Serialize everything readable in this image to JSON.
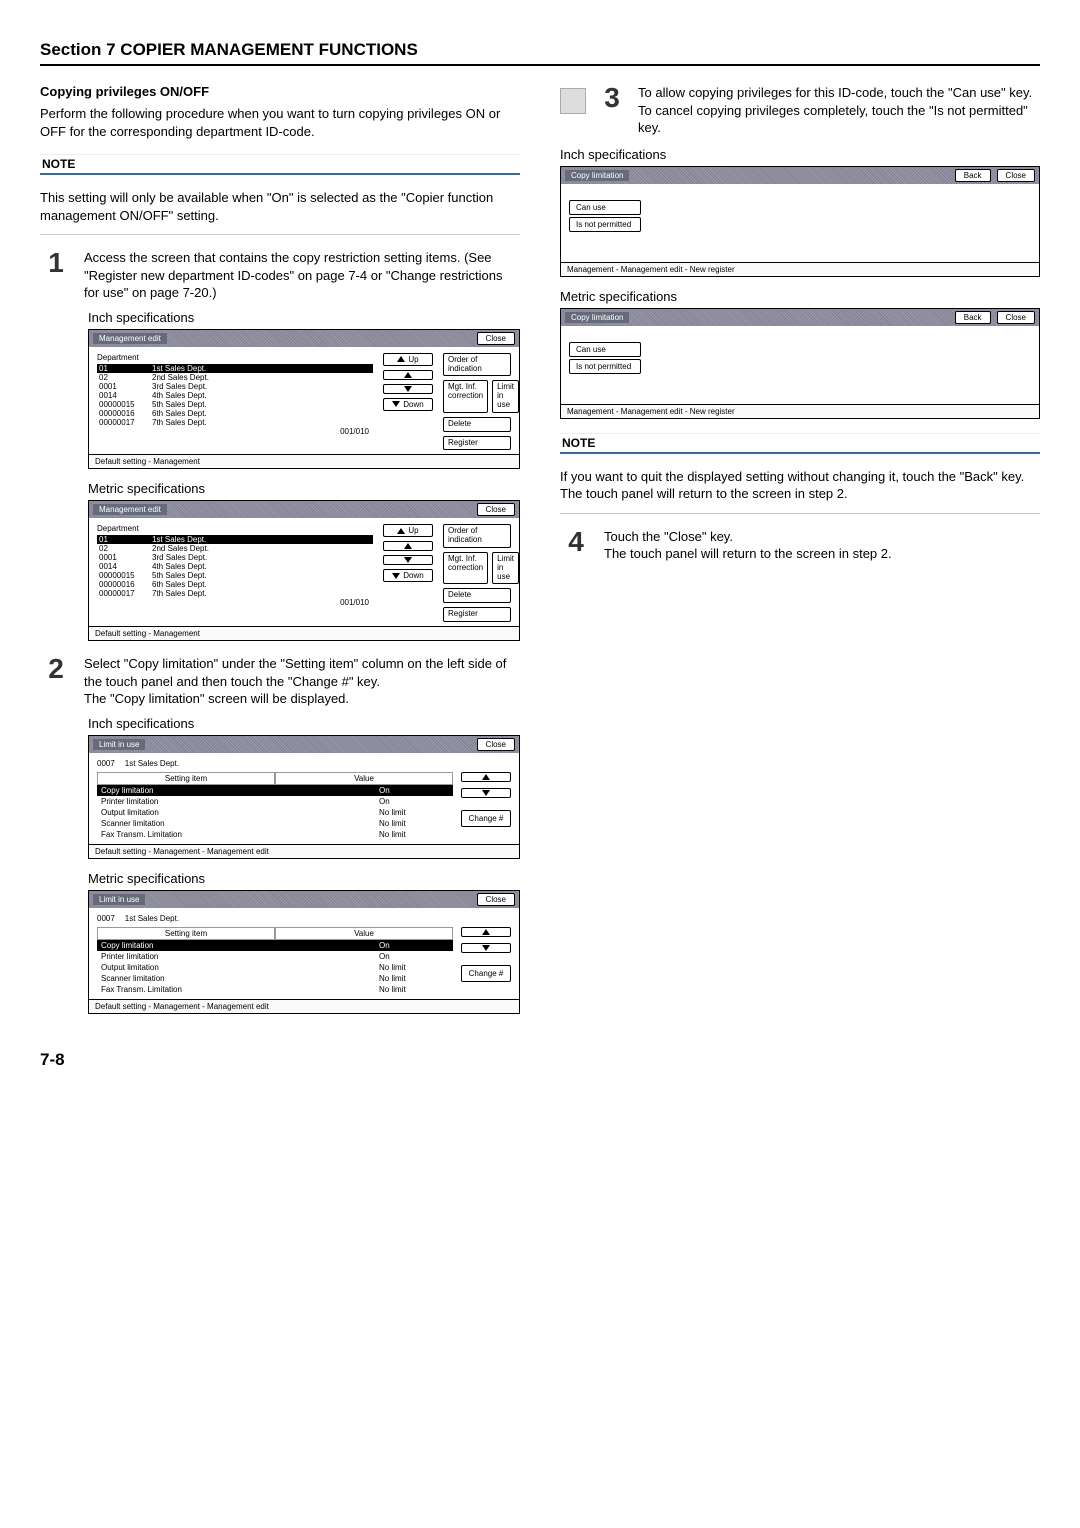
{
  "section_title": "Section 7  COPIER MANAGEMENT FUNCTIONS",
  "left": {
    "sub1_title": "Copying privileges ON/OFF",
    "sub1_para": "Perform the following procedure when you want to turn copying privileges ON or OFF for the corresponding department ID-code.",
    "note_label": "NOTE",
    "note_text": "This setting will only be available when \"On\" is selected as the \"Copier function management ON/OFF\" setting.",
    "step1_num": "1",
    "step1_text": "Access the screen that contains the copy restriction setting items. (See \"Register new department ID-codes\" on page 7-4 or \"Change restrictions for use\" on page 7-20.)",
    "inch_label": "Inch specifications",
    "metric_label": "Metric specifications",
    "step2_num": "2",
    "step2_text1": "Select \"Copy limitation\" under the \"Setting item\" column on the left side of the touch panel and then touch the \"Change #\" key.",
    "step2_text2": "The \"Copy limitation\" screen will be displayed."
  },
  "right": {
    "step3_num": "3",
    "step3_text": "To allow copying privileges for this ID-code, touch the \"Can use\" key. To cancel copying privileges completely, touch the \"Is not permitted\" key.",
    "inch_label": "Inch specifications",
    "metric_label": "Metric specifications",
    "note_label": "NOTE",
    "note_text": "If you want to quit the displayed setting without changing it, touch the \"Back\" key. The touch panel will return to the screen in step 2.",
    "step4_num": "4",
    "step4_text1": "Touch the \"Close\" key.",
    "step4_text2": "The touch panel will return to the screen in step 2."
  },
  "mgmt_panel": {
    "title": "Management edit",
    "close": "Close",
    "dept_hdr": "Department",
    "rows": [
      {
        "id": "01",
        "name": "1st Sales Dept."
      },
      {
        "id": "02",
        "name": "2nd Sales Dept."
      },
      {
        "id": "0001",
        "name": "3rd Sales Dept."
      },
      {
        "id": "0014",
        "name": "4th Sales Dept."
      },
      {
        "id": "00000015",
        "name": "5th Sales Dept."
      },
      {
        "id": "00000016",
        "name": "6th Sales Dept."
      },
      {
        "id": "00000017",
        "name": "7th Sales Dept."
      }
    ],
    "pager": "001/010",
    "footer": "Default setting - Management",
    "up": "Up",
    "down": "Down",
    "order": "Order of indication",
    "mgt": "Mgt. Inf. correction",
    "limit": "Limit in use",
    "delete": "Delete",
    "register": "Register"
  },
  "limit_panel": {
    "title": "Limit in use",
    "close": "Close",
    "id": "0007",
    "dept": "1st Sales Dept.",
    "hdr1": "Setting item",
    "hdr2": "Value",
    "rows": [
      {
        "item": "Copy limitation",
        "val": "On"
      },
      {
        "item": "Printer limitation",
        "val": "On"
      },
      {
        "item": "Output limitation",
        "val": "No limit"
      },
      {
        "item": "Scanner limitation",
        "val": "No limit"
      },
      {
        "item": "Fax Transm. Limitation",
        "val": "No limit"
      }
    ],
    "change": "Change #",
    "footer": "Default setting - Management - Management edit"
  },
  "cl_panel": {
    "title": "Copy limitation",
    "back": "Back",
    "close": "Close",
    "can": "Can use",
    "not": "Is not permitted",
    "footer": "Management - Management edit - New register"
  },
  "page_num": "7-8"
}
